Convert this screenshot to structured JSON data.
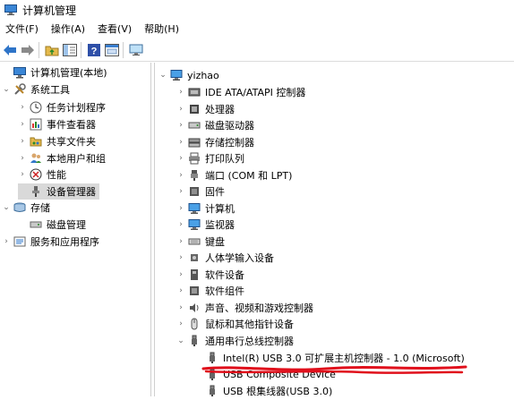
{
  "window": {
    "title": "计算机管理"
  },
  "menu": [
    "文件(F)",
    "操作(A)",
    "查看(V)",
    "帮助(H)"
  ],
  "toolbar": {
    "icons": [
      "back-arrow-icon",
      "forward-arrow-icon",
      "up-folder-icon",
      "show-hide-tree-icon",
      "help-icon",
      "properties-icon",
      "monitor-icon"
    ]
  },
  "left_tree": [
    {
      "label": "计算机管理(本地)",
      "icon": "computer-management-icon",
      "level": 0,
      "chevron": ""
    },
    {
      "label": "系统工具",
      "icon": "tools-icon",
      "level": 0,
      "chevron": "expanded"
    },
    {
      "label": "任务计划程序",
      "icon": "clock-icon",
      "level": 1,
      "chevron": "collapsed"
    },
    {
      "label": "事件查看器",
      "icon": "event-viewer-icon",
      "level": 1,
      "chevron": "collapsed"
    },
    {
      "label": "共享文件夹",
      "icon": "shared-folder-icon",
      "level": 1,
      "chevron": "collapsed"
    },
    {
      "label": "本地用户和组",
      "icon": "users-icon",
      "level": 1,
      "chevron": "collapsed"
    },
    {
      "label": "性能",
      "icon": "performance-icon",
      "level": 1,
      "chevron": "collapsed"
    },
    {
      "label": "设备管理器",
      "icon": "device-manager-icon",
      "level": 1,
      "chevron": "",
      "selected": true
    },
    {
      "label": "存储",
      "icon": "storage-icon",
      "level": 0,
      "chevron": "expanded"
    },
    {
      "label": "磁盘管理",
      "icon": "disk-management-icon",
      "level": 1,
      "chevron": ""
    },
    {
      "label": "服务和应用程序",
      "icon": "services-icon",
      "level": 0,
      "chevron": "collapsed"
    }
  ],
  "device_tree": {
    "root": {
      "label": "yizhao",
      "icon": "computer-icon"
    },
    "categories": [
      {
        "label": "IDE ATA/ATAPI 控制器",
        "icon": "ide-controller-icon",
        "chevron": "collapsed"
      },
      {
        "label": "处理器",
        "icon": "processor-icon",
        "chevron": "collapsed"
      },
      {
        "label": "磁盘驱动器",
        "icon": "disk-drive-icon",
        "chevron": "collapsed"
      },
      {
        "label": "存储控制器",
        "icon": "storage-controller-icon",
        "chevron": "collapsed"
      },
      {
        "label": "打印队列",
        "icon": "printer-icon",
        "chevron": "collapsed"
      },
      {
        "label": "端口 (COM 和 LPT)",
        "icon": "port-icon",
        "chevron": "collapsed"
      },
      {
        "label": "固件",
        "icon": "firmware-icon",
        "chevron": "collapsed"
      },
      {
        "label": "计算机",
        "icon": "computer-icon",
        "chevron": "collapsed"
      },
      {
        "label": "监视器",
        "icon": "monitor-icon",
        "chevron": "collapsed"
      },
      {
        "label": "键盘",
        "icon": "keyboard-icon",
        "chevron": "collapsed"
      },
      {
        "label": "人体学输入设备",
        "icon": "hid-icon",
        "chevron": "collapsed"
      },
      {
        "label": "软件设备",
        "icon": "software-device-icon",
        "chevron": "collapsed"
      },
      {
        "label": "软件组件",
        "icon": "software-component-icon",
        "chevron": "collapsed"
      },
      {
        "label": "声音、视频和游戏控制器",
        "icon": "sound-icon",
        "chevron": "collapsed"
      },
      {
        "label": "鼠标和其他指针设备",
        "icon": "mouse-icon",
        "chevron": "collapsed"
      },
      {
        "label": "通用串行总线控制器",
        "icon": "usb-icon",
        "chevron": "expanded"
      }
    ],
    "usb_children": [
      {
        "label": "Intel(R) USB 3.0 可扩展主机控制器 - 1.0 (Microsoft)",
        "icon": "usb-icon",
        "highlighted": true
      },
      {
        "label": "USB Composite Device",
        "icon": "usb-icon"
      },
      {
        "label": "USB 根集线器(USB 3.0)",
        "icon": "usb-icon"
      }
    ]
  },
  "colors": {
    "accent": "#1e7ad6",
    "scribble": "#e0101c",
    "selected_bg": "#d9d9d9"
  }
}
